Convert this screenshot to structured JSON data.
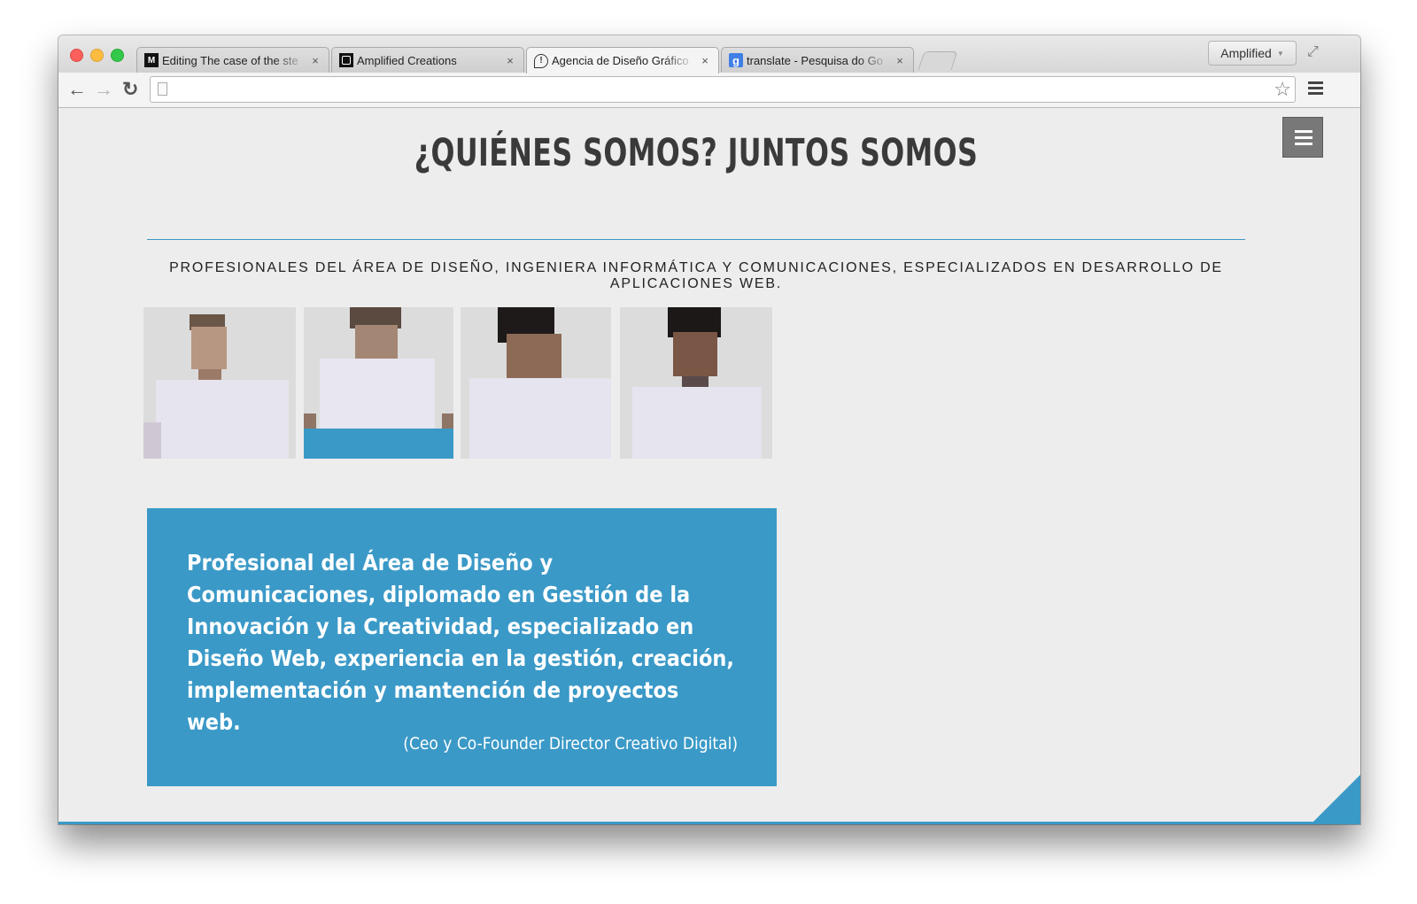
{
  "browser": {
    "tabs": [
      {
        "favicon_icon": "medium-m-icon",
        "favicon_text": "M",
        "title": "Editing The case of the ste",
        "close": "×"
      },
      {
        "favicon_icon": "amplified-square-icon",
        "favicon_text": "",
        "title": "Amplified Creations",
        "close": "×"
      },
      {
        "favicon_icon": "speech-bubble-icon",
        "favicon_text": "!",
        "title": "Agencia de Diseño Gráfico",
        "close": "×"
      },
      {
        "favicon_icon": "google-g-icon",
        "favicon_text": "g",
        "title": "translate - Pesquisa do Go",
        "close": "×"
      }
    ],
    "active_tab": 2,
    "profile_label": "Amplified",
    "address_value": ""
  },
  "icons": {
    "back": "←",
    "forward": "→",
    "reload": "↻",
    "star": "☆",
    "fullscreen": "⤢",
    "profile_caret": "▼"
  },
  "page": {
    "heading": "¿QUIÉNES SOMOS? JUNTOS SOMOS",
    "subtitle": "PROFESIONALES DEL ÁREA DE DISEÑO, INGENIERA INFORMÁTICA Y COMUNICACIONES, ESPECIALIZADOS EN DESARROLLO DE APLICACIONES WEB.",
    "team_photos": [
      "team-member-1",
      "team-member-2",
      "team-member-3",
      "team-member-4"
    ],
    "selected_photo": 1,
    "quote": "Profesional del Área de Diseño y Comunicaciones, diplomado en Gestión de la Innovación y la Creatividad, especializado en Diseño Web, experiencia en la gestión, creación, implementación y mantención de proyectos web.",
    "role": "(Ceo y Co-Founder Director Creativo Digital)"
  },
  "colors": {
    "accent": "#3a99c7",
    "heading": "#3a3a3a",
    "page_bg": "#ededed"
  }
}
